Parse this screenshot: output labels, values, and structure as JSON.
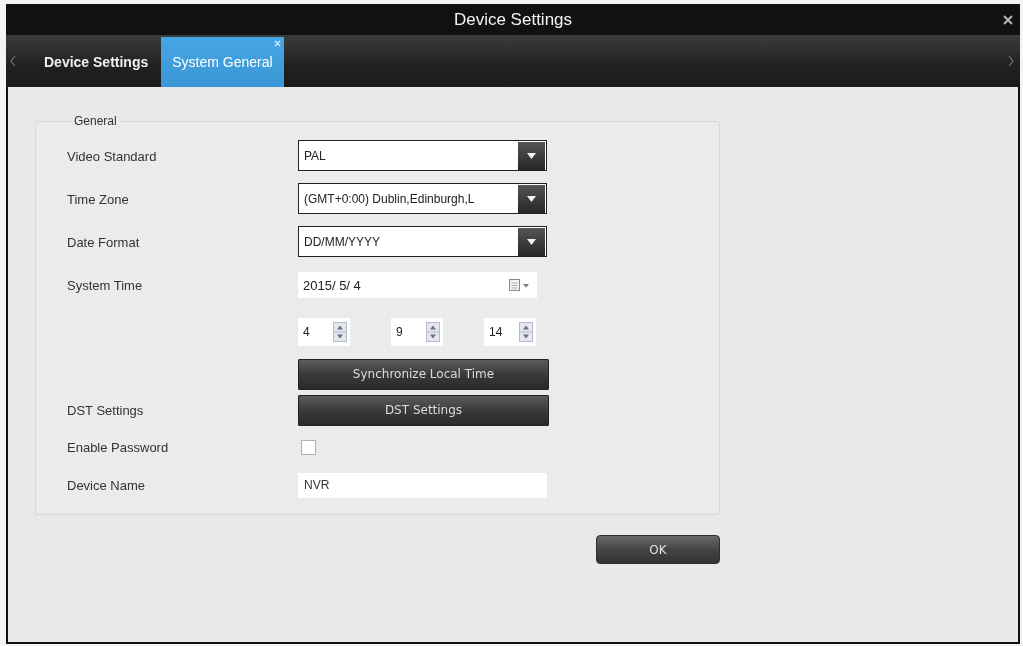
{
  "window": {
    "title": "Device Settings"
  },
  "tabs": [
    {
      "label": "Device Settings",
      "selected": false
    },
    {
      "label": "System General",
      "selected": true
    }
  ],
  "group": {
    "title": "General",
    "rows": [
      {
        "kind": "select",
        "label": "Video Standard",
        "value": "PAL"
      },
      {
        "kind": "select",
        "label": "Time Zone",
        "value": "(GMT+0:00) Dublin,Edinburgh,L"
      },
      {
        "kind": "select",
        "label": "Date Format",
        "value": "DD/MM/YYYY"
      },
      {
        "kind": "date",
        "label": "System Time",
        "value": "2015/ 5/ 4"
      },
      {
        "kind": "spinners",
        "values": [
          "4",
          "9",
          "14"
        ]
      },
      {
        "kind": "button",
        "text": "Synchronize Local Time"
      },
      {
        "kind": "button",
        "label": "DST Settings",
        "text": "DST Settings"
      },
      {
        "kind": "checkbox",
        "label": "Enable Password",
        "checked": false
      },
      {
        "kind": "text",
        "label": "Device Name",
        "value": "NVR"
      }
    ]
  },
  "buttons": [
    "OK"
  ]
}
